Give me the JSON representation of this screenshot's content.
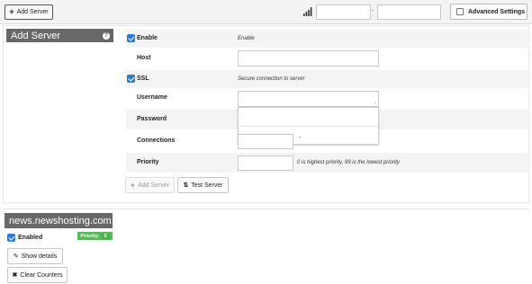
{
  "toolbar": {
    "add_server": "Add Server",
    "separator": "-",
    "advanced_settings": "Advanced Settings",
    "signal_icon": "signal-bars-icon"
  },
  "form": {
    "title": "Add Server",
    "help_icon": "?",
    "enable": {
      "label": "Enable",
      "checked": true,
      "description": "Enable"
    },
    "host": {
      "label": "Host",
      "value": ""
    },
    "ssl": {
      "label": "SSL",
      "checked": true,
      "description": "Secure connection to server"
    },
    "username": {
      "label": "Username",
      "value": ""
    },
    "password": {
      "label": "Password",
      "value": ""
    },
    "connections": {
      "label": "Connections",
      "value": ""
    },
    "priority": {
      "label": "Priority",
      "value": "",
      "description": "0 is highest priority, 99 is the lowest priority"
    },
    "add_button": "Add Server",
    "test_button": "Test Server"
  },
  "server": {
    "name": "news.newshosting.com",
    "enabled_label": "Enabled",
    "priority_label": "Priority:",
    "priority_value": "0",
    "show_details": "Show details",
    "clear_counters": "Clear Counters"
  }
}
